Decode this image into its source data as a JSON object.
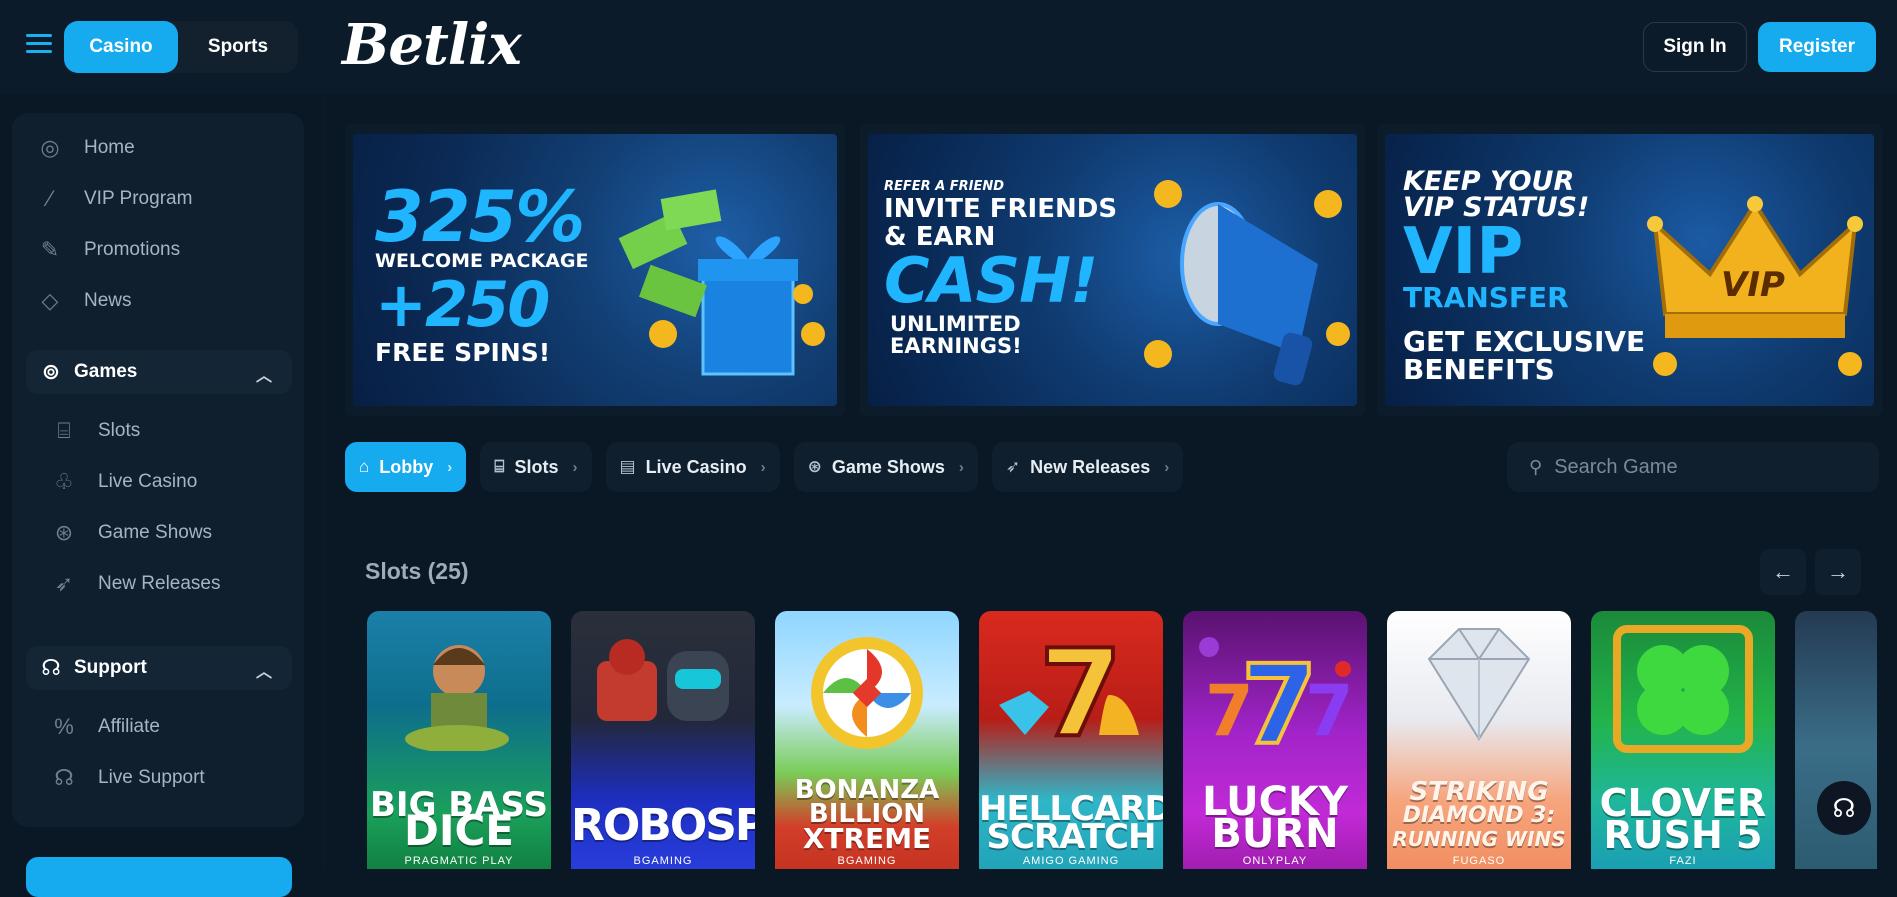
{
  "header": {
    "mode_casino": "Casino",
    "mode_sports": "Sports",
    "logo": "Betlix",
    "signin": "Sign In",
    "register": "Register"
  },
  "sidebar": {
    "items": [
      {
        "label": "Home",
        "icon": "home-icon"
      },
      {
        "label": "VIP Program",
        "icon": "magic-wand-icon"
      },
      {
        "label": "Promotions",
        "icon": "edit-icon"
      },
      {
        "label": "News",
        "icon": "diamond-icon"
      }
    ],
    "games": {
      "label": "Games",
      "items": [
        {
          "label": "Slots",
          "icon": "slot-machine-icon"
        },
        {
          "label": "Live Casino",
          "icon": "cherries-icon"
        },
        {
          "label": "Game Shows",
          "icon": "roulette-icon"
        },
        {
          "label": "New Releases",
          "icon": "rocket-icon"
        }
      ]
    },
    "support": {
      "label": "Support",
      "items": [
        {
          "label": "Affiliate",
          "icon": "percent-badge-icon"
        },
        {
          "label": "Live Support",
          "icon": "headset-icon"
        }
      ]
    }
  },
  "banners": [
    {
      "line1": "325%",
      "line2": "WELCOME PACKAGE",
      "line3": "+250",
      "line4": "FREE SPINS!"
    },
    {
      "line1": "REFER A FRIEND",
      "line2": "INVITE FRIENDS",
      "line3": "& EARN",
      "line4": "CASH!",
      "line5": "UNLIMITED",
      "line6": "EARNINGS!"
    },
    {
      "line1": "KEEP YOUR",
      "line2": "VIP STATUS!",
      "line3": "VIP",
      "line4": "TRANSFER",
      "line5": "GET EXCLUSIVE",
      "line6": "BENEFITS",
      "crown": "VIP"
    }
  ],
  "tabs": [
    {
      "label": "Lobby",
      "icon": "home-icon",
      "active": true
    },
    {
      "label": "Slots",
      "icon": "slot-machine-icon"
    },
    {
      "label": "Live Casino",
      "icon": "cards-icon"
    },
    {
      "label": "Game Shows",
      "icon": "roulette-icon"
    },
    {
      "label": "New Releases",
      "icon": "rocket-icon"
    }
  ],
  "search": {
    "placeholder": "Search Game"
  },
  "slots": {
    "title": "Slots (25)",
    "games": [
      {
        "title_top": "BIG BASS",
        "title_bottom": "DICE",
        "provider": "PRAGMATIC PLAY"
      },
      {
        "title_top": "ROBOSPIN",
        "title_bottom": "",
        "provider": "BGAMING"
      },
      {
        "title_top": "BONANZA",
        "title_mid": "BILLION",
        "title_bottom": "XTREME",
        "provider": "BGAMING"
      },
      {
        "title_top": "HELLCARDS",
        "title_bottom": "SCRATCH",
        "provider": "AMIGO GAMING"
      },
      {
        "title_top": "LUCKY",
        "title_bottom": "BURN",
        "provider": "ONLYPLAY"
      },
      {
        "title_top": "STRIKING",
        "title_mid": "DIAMOND 3:",
        "title_bottom": "RUNNING WINS",
        "provider": "FUGASO"
      },
      {
        "title_top": "CLOVER",
        "title_bottom": "RUSH 5",
        "provider": "FAZI"
      }
    ]
  },
  "colors": {
    "accent": "#16aaee",
    "background": "#0a1826",
    "panel": "#0f1f2e"
  }
}
